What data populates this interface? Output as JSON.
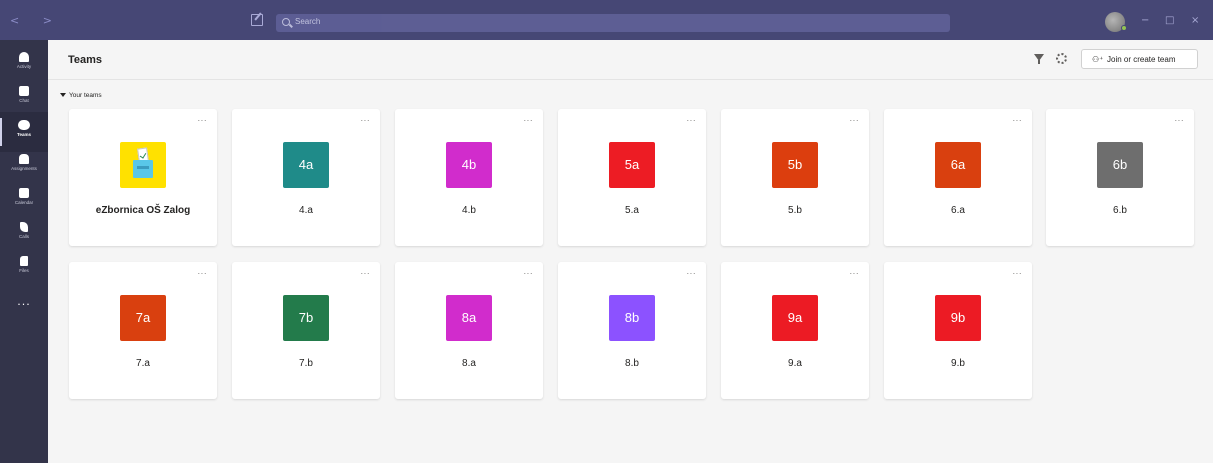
{
  "titlebar": {
    "search_placeholder": "Search",
    "window_controls": [
      "−",
      "□",
      "×"
    ]
  },
  "rail": [
    {
      "label": "Activity",
      "icon": "bell-icon"
    },
    {
      "label": "Chat",
      "icon": "chat-icon"
    },
    {
      "label": "Teams",
      "icon": "teams-icon",
      "active": true
    },
    {
      "label": "Assignments",
      "icon": "backpack-icon"
    },
    {
      "label": "Calendar",
      "icon": "calendar-icon"
    },
    {
      "label": "Calls",
      "icon": "phone-icon"
    },
    {
      "label": "Files",
      "icon": "file-icon"
    }
  ],
  "rail_more": "···",
  "header": {
    "title": "Teams",
    "join_label": "Join or create team"
  },
  "section": {
    "label": "Your teams"
  },
  "teams": [
    {
      "name": "eZbornica OŠ Zalog",
      "tile": "",
      "color": "#ffe100",
      "logo": true
    },
    {
      "name": "4.a",
      "tile": "4a",
      "color": "#1f8b89"
    },
    {
      "name": "4.b",
      "tile": "4b",
      "color": "#d12ccc"
    },
    {
      "name": "5.a",
      "tile": "5a",
      "color": "#ed1c24"
    },
    {
      "name": "5.b",
      "tile": "5b",
      "color": "#dc3e0e"
    },
    {
      "name": "6.a",
      "tile": "6a",
      "color": "#d9400f"
    },
    {
      "name": "6.b",
      "tile": "6b",
      "color": "#6e6e6e"
    },
    {
      "name": "7.a",
      "tile": "7a",
      "color": "#d9400f"
    },
    {
      "name": "7.b",
      "tile": "7b",
      "color": "#237b4b"
    },
    {
      "name": "8.a",
      "tile": "8a",
      "color": "#d12ccc"
    },
    {
      "name": "8.b",
      "tile": "8b",
      "color": "#8c52ff"
    },
    {
      "name": "9.a",
      "tile": "9a",
      "color": "#ec1b24"
    },
    {
      "name": "9.b",
      "tile": "9b",
      "color": "#ec1b24"
    }
  ],
  "card_menu": "···",
  "colors": {
    "titlebar": "#464775",
    "rail": "#33344a",
    "background": "#f5f5f5"
  }
}
